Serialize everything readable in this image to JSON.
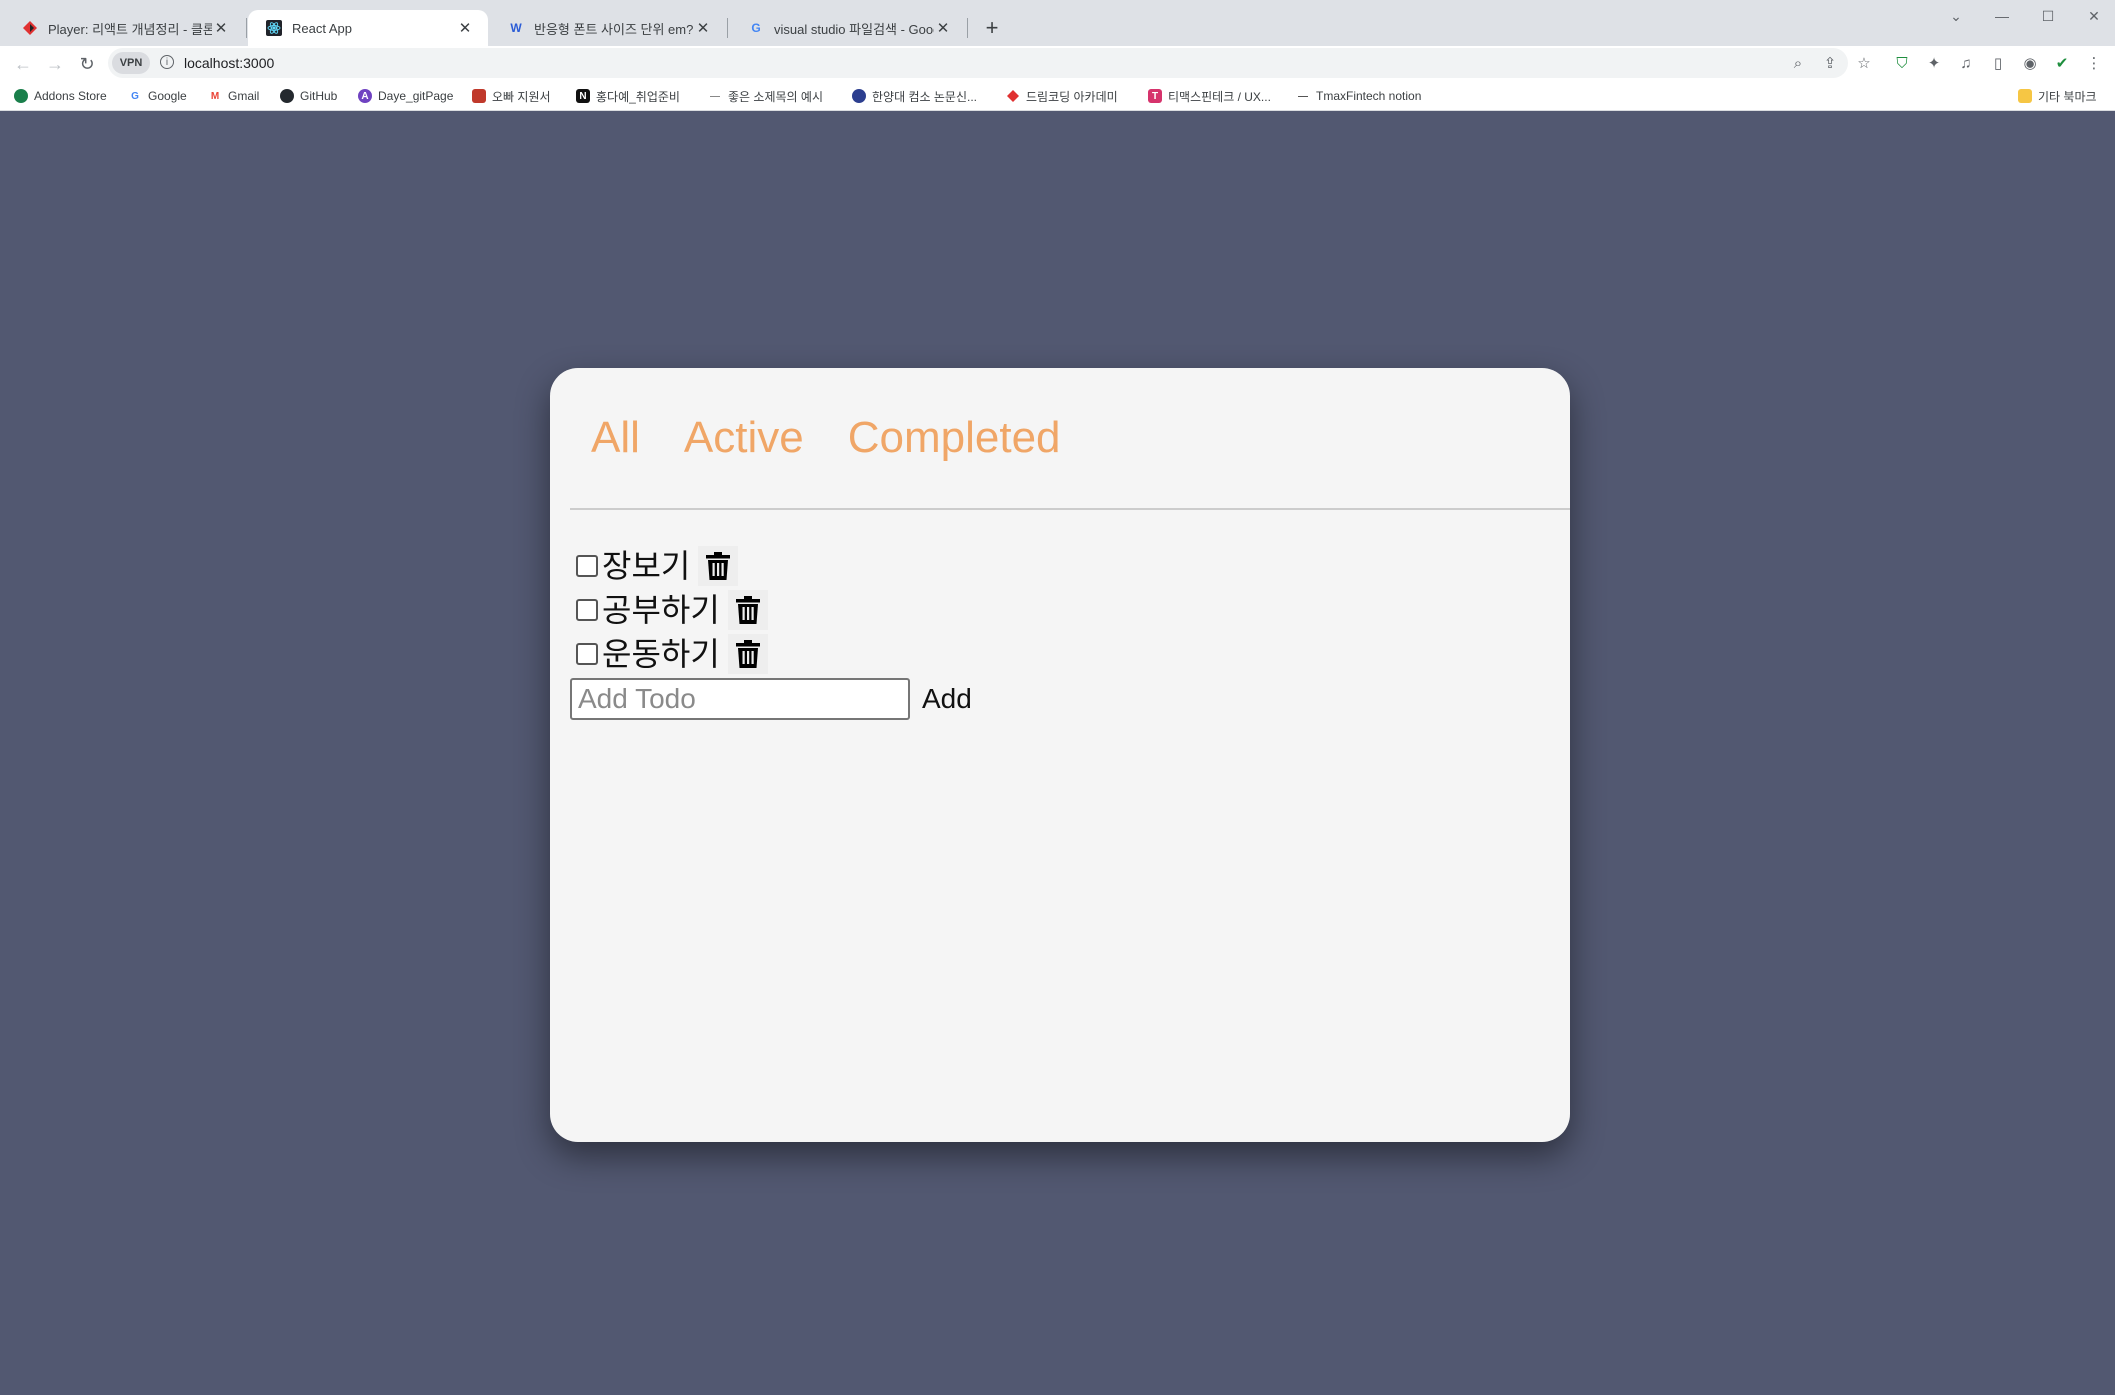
{
  "browser": {
    "tabs": [
      {
        "title": "Player: 리액트 개념정리 - 클론코",
        "favicon": "dreamcoding-icon",
        "active": false
      },
      {
        "title": "React App",
        "favicon": "react-icon",
        "active": true
      },
      {
        "title": "반응형 폰트 사이즈 단위 em? re",
        "favicon": "wordpress-icon",
        "active": false
      },
      {
        "title": "visual studio 파일검색 - Google",
        "favicon": "google-icon",
        "active": false
      }
    ],
    "new_tab_label": "+",
    "vpn_label": "VPN",
    "url": "localhost:3000",
    "bookmarks": [
      {
        "label": "Addons Store",
        "color": "#1a7f4b"
      },
      {
        "label": "Google",
        "color": "#4285f4"
      },
      {
        "label": "Gmail",
        "color": "#ea4335"
      },
      {
        "label": "GitHub",
        "color": "#24292e"
      },
      {
        "label": "Daye_gitPage",
        "color": "#6f42c1"
      },
      {
        "label": "오빠 지원서",
        "color": "#c0392b"
      },
      {
        "label": "홍다예_취업준비",
        "color": "#111111"
      },
      {
        "label": "좋은 소제목의 예시",
        "color": "#888888"
      },
      {
        "label": "한양대 컴소 논문신...",
        "color": "#2c3e8f"
      },
      {
        "label": "드림코딩 아카데미",
        "color": "#e03131"
      },
      {
        "label": "티맥스핀테크 / UX...",
        "color": "#d6336c"
      },
      {
        "label": "TmaxFintech notion",
        "color": "#555555"
      }
    ],
    "other_bookmarks": "기타 북마크"
  },
  "app": {
    "filters": [
      "All",
      "Active",
      "Completed"
    ],
    "todos": [
      {
        "text": "장보기",
        "checked": false
      },
      {
        "text": "공부하기",
        "checked": false
      },
      {
        "text": "운동하기",
        "checked": false
      }
    ],
    "add_placeholder": "Add Todo",
    "add_value": "",
    "add_button": "Add",
    "accent_color": "#f0a667",
    "background_color": "#525871",
    "card_color": "#f5f5f5"
  }
}
